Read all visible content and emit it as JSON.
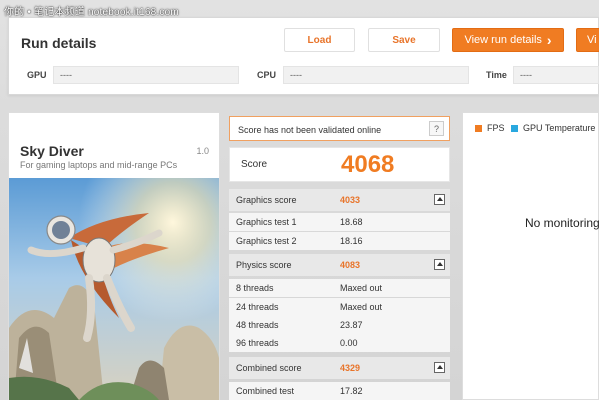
{
  "watermark": "你的 • 笔记本频道 notebook.it168.com",
  "run_details": {
    "title": "Run details",
    "load_label": "Load",
    "save_label": "Save",
    "view_label": "View run details",
    "view_arrow": "›",
    "view2_label": "Vi",
    "gpu_label": "GPU",
    "gpu_value": "----",
    "cpu_label": "CPU",
    "cpu_value": "----",
    "time_label": "Time",
    "time_value": "----"
  },
  "test": {
    "name": "Sky Diver",
    "version": "1.0",
    "subtitle": "For gaming laptops and mid-range PCs"
  },
  "results": {
    "validation_message": "Score has not been validated online",
    "help_label": "?",
    "score_label": "Score",
    "score_value": "4068",
    "sections": [
      {
        "label": "Graphics score",
        "value": "4033",
        "rows": [
          {
            "label": "Graphics test 1",
            "value": "18.68"
          },
          {
            "label": "Graphics test 2",
            "value": "18.16"
          }
        ]
      },
      {
        "label": "Physics score",
        "value": "4083",
        "rows": [
          {
            "label": "8 threads",
            "value": "Maxed out"
          },
          {
            "label": "24 threads",
            "value": "Maxed out"
          },
          {
            "label": "48 threads",
            "value": "23.87"
          },
          {
            "label": "96 threads",
            "value": "0.00"
          }
        ]
      },
      {
        "label": "Combined score",
        "value": "4329",
        "rows": [
          {
            "label": "Combined test",
            "value": "17.82"
          }
        ]
      }
    ]
  },
  "monitoring": {
    "legend": [
      {
        "label": "FPS",
        "color": "#f07c22"
      },
      {
        "label": "GPU Temperature",
        "color": "#29a8df"
      }
    ],
    "no_data_message": "No monitoring"
  },
  "colors": {
    "accent": "#f07c22",
    "panel_bg": "#ffffff"
  }
}
